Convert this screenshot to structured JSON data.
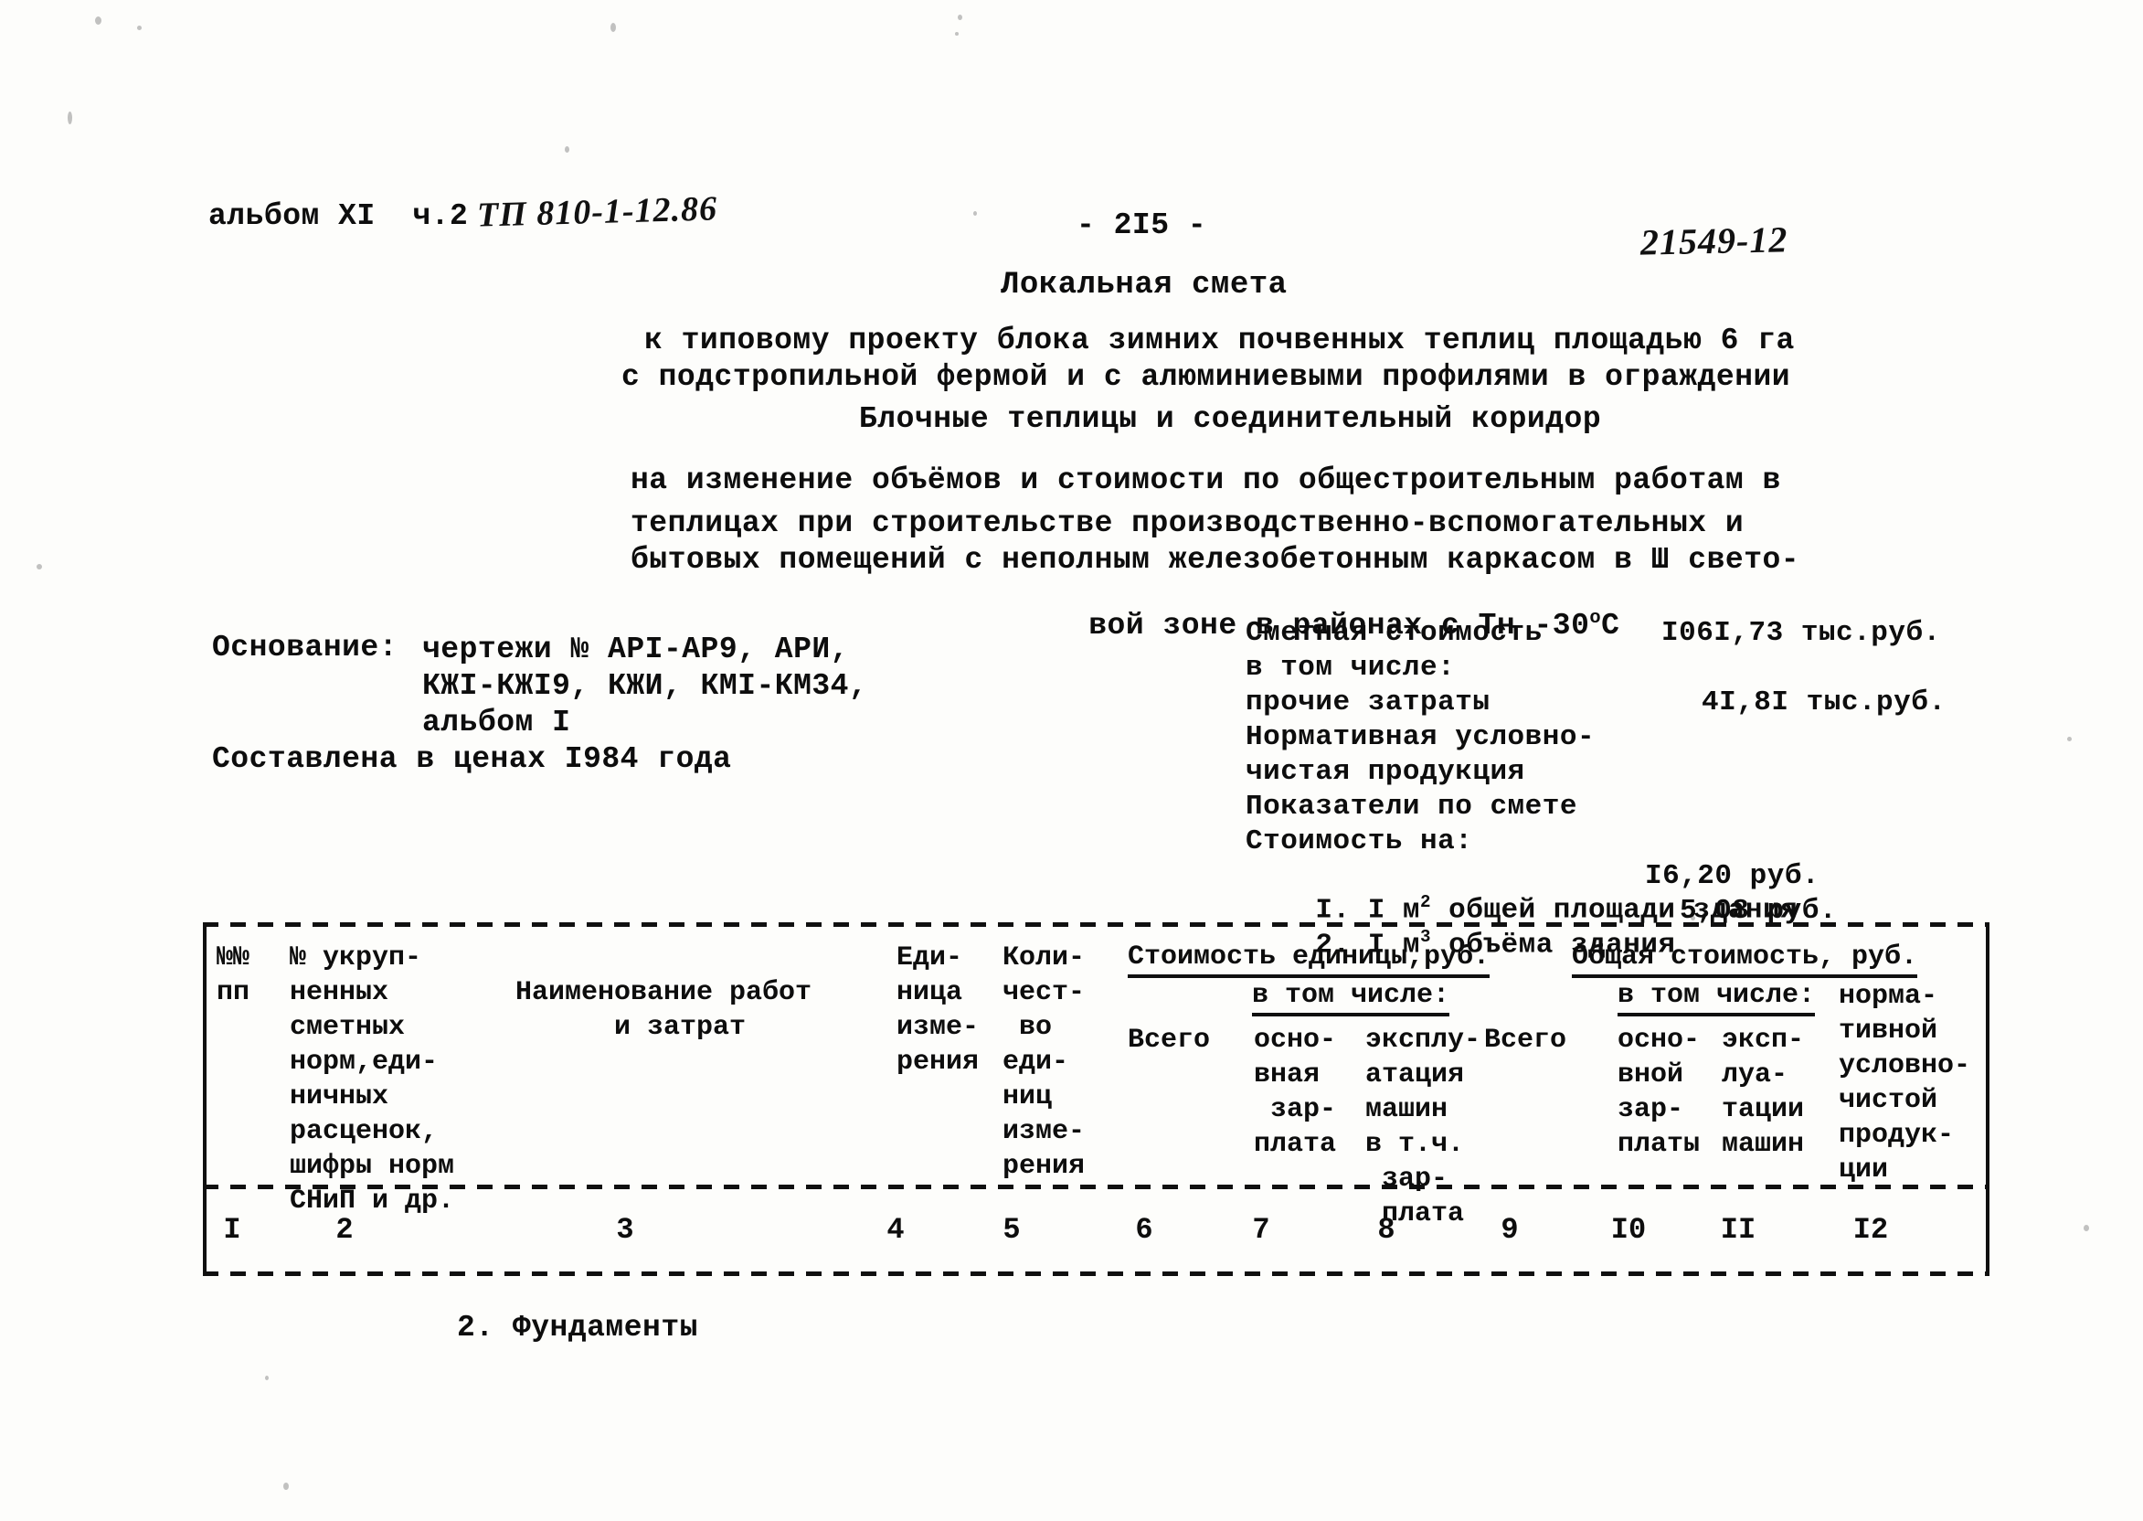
{
  "header": {
    "album": "альбом XI  ч.2",
    "project_code_handwritten": "ТП 810-1-12.86",
    "page_number": "- 2I5 -",
    "archive_number_handwritten": "21549-12"
  },
  "title": {
    "main": "Локальная смета",
    "subject_line_1": "к типовому проекту блока зимних почвенных теплиц площадью 6 га",
    "subject_line_2": "с подстропильной фермой и с алюминиевыми профилями в ограждении",
    "object": "Блочные теплицы и соединительный коридор",
    "scope_line_1": "на изменение объёмов и стоимости по общестроительным работам в",
    "scope_line_2": "теплицах при строительстве производственно-вспомогательных и",
    "scope_line_3": "бытовых помещений с неполным железобетонным каркасом в Ш свето-",
    "scope_line_4": "вой зоне в районах с Тн -30",
    "scope_line_4_sup": "о",
    "scope_line_4_tail": "С"
  },
  "basis": {
    "label": "Основание:",
    "line_1": "чертежи № АРI-АР9, АРИ,",
    "line_2": "КЖI-КЖI9, КЖИ, КМI-КМ34,",
    "line_3": "альбом I",
    "prices_note": "Составлена в ценах I984 года"
  },
  "summary": {
    "rows": [
      {
        "label": "Сметная стоимость",
        "value": "I06I,73 тыс.руб."
      },
      {
        "label": "в том числе:",
        "value": ""
      },
      {
        "label": "прочие затраты",
        "value": "4I,8I тыс.руб."
      },
      {
        "label": "Нормативная условно-",
        "value": ""
      },
      {
        "label": "чистая продукция",
        "value": ""
      },
      {
        "label": "Показатели по смете",
        "value": ""
      },
      {
        "label": "Стоимость на:",
        "value": ""
      }
    ],
    "indicator_1": {
      "num": "I. I м",
      "sup": "2",
      "text": " общей площади здания",
      "value": "I6,20 руб."
    },
    "indicator_2": {
      "num": "2. I м",
      "sup": "3",
      "text": " объёма здания",
      "value": "5,08 руб."
    }
  },
  "table": {
    "columns": [
      {
        "number": "I",
        "header": "№№\nпп"
      },
      {
        "number": "2",
        "header": "№ укруп-\nненных\nсметных\nнорм,еди-\nничных\nрасценок,\nшифры норм\nСНиП и др."
      },
      {
        "number": "3",
        "header": "Наименование работ\n      и затрат"
      },
      {
        "number": "4",
        "header": "Еди-\nница\nизме-\nрения"
      },
      {
        "number": "5",
        "header": "Коли-\nчест-\n во\nеди-\nниц\nизме-\nрения"
      },
      {
        "number": "6",
        "header": "Всего"
      },
      {
        "number": "7",
        "header": "осно-\nвная\n зар-\nплата"
      },
      {
        "number": "8",
        "header": "эксплу-\nатация\nмашин\nв т.ч.\n зар-\n плата"
      },
      {
        "number": "9",
        "header": "Всего"
      },
      {
        "number": "I0",
        "header": "осно-\nвной\nзар-\nплаты"
      },
      {
        "number": "II",
        "header": "эксп-\nлуа-\nтации\nмашин"
      },
      {
        "number": "I2",
        "header": "норма-\nтивной\nусловно-\nчистой\nпродук-\nции"
      }
    ],
    "group_unit_cost": "Стоимость единицы,руб.",
    "group_total_cost": "Общая стоимость, руб.",
    "subgroup_unit": "в том числе:",
    "subgroup_total": "в том числе:"
  },
  "section": {
    "heading": "2. Фундаменты"
  }
}
